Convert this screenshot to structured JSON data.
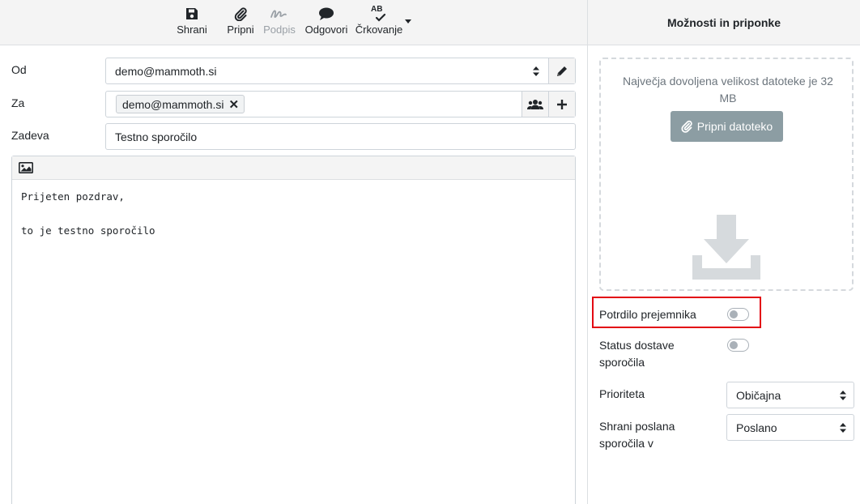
{
  "toolbar": {
    "save": "Shrani",
    "attach": "Pripni",
    "signature": "Podpis",
    "respond": "Odgovori",
    "spell_icon_text": "AB",
    "spellcheck": "Črkovanje"
  },
  "form": {
    "from_label": "Od",
    "from_value": "demo@mammoth.si",
    "to_label": "Za",
    "to_recipient": "demo@mammoth.si",
    "to_remove": "✕",
    "subject_label": "Zadeva",
    "subject_value": "Testno sporočilo"
  },
  "body_lines": [
    "Prijeten pozdrav,",
    "",
    "to je testno sporočilo"
  ],
  "panel": {
    "title": "Možnosti in priponke",
    "max_size_text": "Največja dovoljena velikost datoteke je 32 MB",
    "attach_button": "Pripni datoteko",
    "receipt_label": "Potrdilo prejemnika",
    "receipt_on": false,
    "dsn_label": "Status dostave sporočila",
    "dsn_on": false,
    "priority_label": "Prioriteta",
    "priority_value": "Običajna",
    "store_label": "Shrani poslana sporočila v",
    "store_value": "Poslano"
  },
  "colors": {
    "highlight": "#e30613",
    "attach_button": "#8c9da3"
  }
}
